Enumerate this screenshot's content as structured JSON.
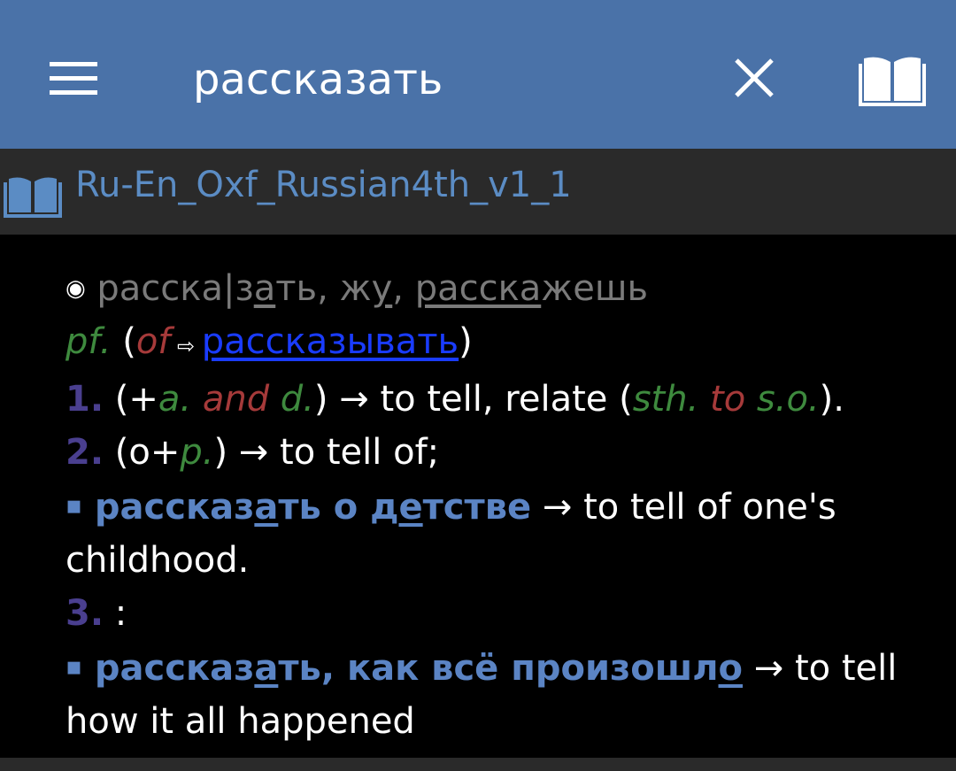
{
  "appbar": {
    "query": "рассказать",
    "menu_icon": "menu-icon",
    "close_icon": "close-icon",
    "dictionary_icon": "book-icon",
    "background": "#4a72a8"
  },
  "dictionary": {
    "name": "Ru-En_Oxf_Russian4th_v1_1",
    "icon": "book-icon"
  },
  "entry": {
    "headword": {
      "marker": "◉",
      "p1": "расска",
      "p2": "|з",
      "p3": "а",
      "p4": "ть, ж",
      "p5": "у",
      "p6": ", ",
      "p7": "расска",
      "p8": "жешь"
    },
    "grammar": {
      "pos": "pf.",
      "open": " (",
      "of": "of",
      "arrow": " ⇨ ",
      "link": "рассказывать",
      "close": ")"
    },
    "sense1": {
      "num": "1.",
      "t1": " (+",
      "a": "a.",
      "and": " and ",
      "d": "d.",
      "t2": ") → to tell, relate (",
      "sth": "sth.",
      "to": " to ",
      "so": "s.o.",
      "t3": ")."
    },
    "sense2": {
      "num": "2.",
      "t1": " (о+",
      "p": "p.",
      "t2": ") → to tell of;"
    },
    "example1": {
      "bullet": "▪",
      "ru1": " расск",
      "ru1u": "а",
      "ru1b": "з",
      "ru2": "а",
      "ru3": "ть о д",
      "ru4": "е",
      "ru5": "тстве",
      "en": " → to tell of one's",
      "en2": "childhood."
    },
    "sense3": {
      "num": "3.",
      "t1": " :"
    },
    "example2": {
      "bullet": "▪",
      "ru1": " рассказ",
      "ru2": "а",
      "ru3": "ть, как всё произошл",
      "ru4": "о",
      "en": " → to tell",
      "en2": "how it all happened"
    }
  }
}
